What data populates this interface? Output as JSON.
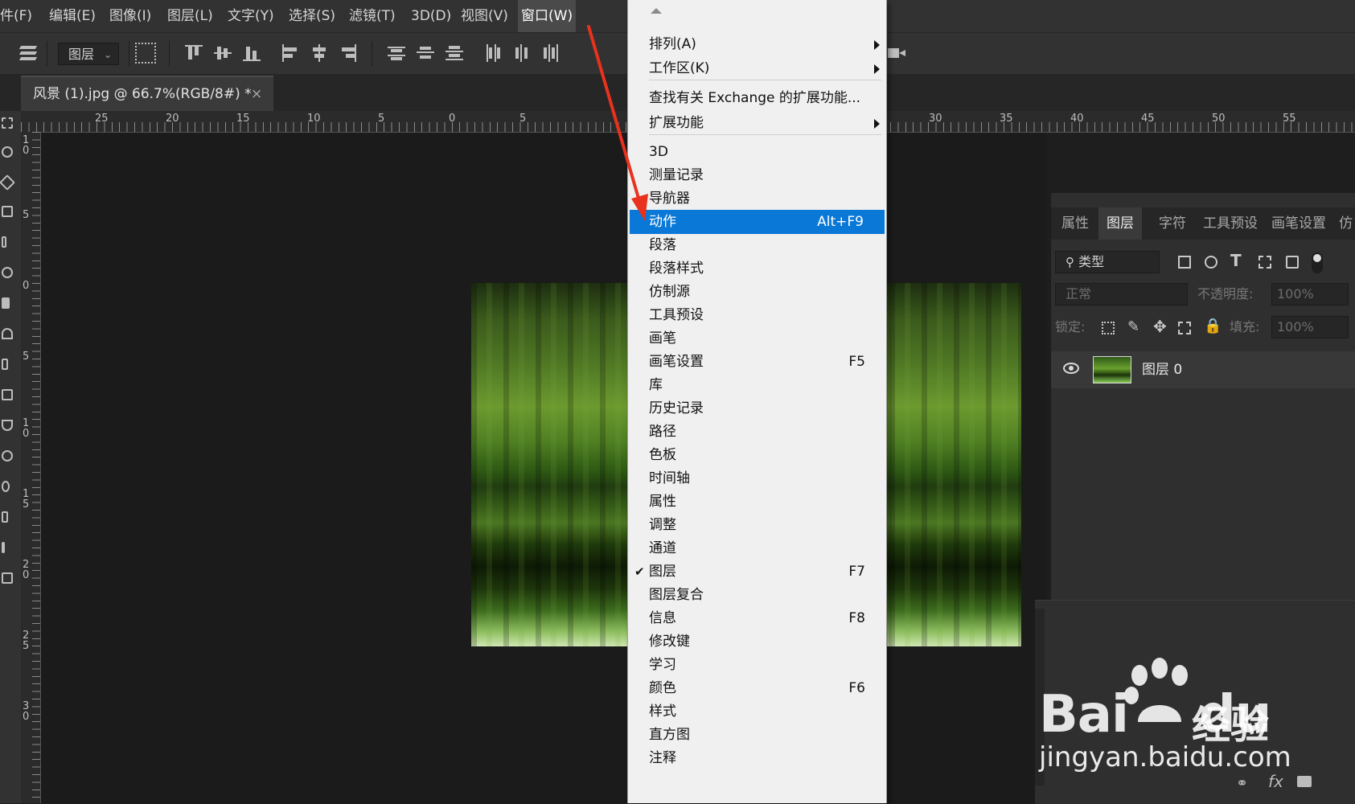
{
  "menubar": {
    "items": [
      "文件(F)",
      "编辑(E)",
      "图像(I)",
      "图层(L)",
      "文字(Y)",
      "选择(S)",
      "滤镜(T)",
      "3D(D)",
      "视图(V)",
      "窗口(W)"
    ],
    "visible_first": "件(F)"
  },
  "optionsbar": {
    "layer_select": "图层"
  },
  "document": {
    "tab_title": "风景 (1).jpg @ 66.7%(RGB/8#) *",
    "close": "×"
  },
  "ruler": {
    "h_labels": [
      "25",
      "20",
      "15",
      "10",
      "5",
      "0",
      "30",
      "35",
      "40",
      "45",
      "50",
      "55"
    ],
    "v_labels": [
      "1\n0",
      "5",
      "0",
      "5",
      "1\n0",
      "1\n5",
      "2\n0",
      "2\n5",
      "3\n0"
    ]
  },
  "window_menu": {
    "items": [
      {
        "label": "排列(A)",
        "submenu": true
      },
      {
        "label": "工作区(K)",
        "submenu": true
      },
      {
        "label": "查找有关 Exchange 的扩展功能..."
      },
      {
        "label": "扩展功能",
        "submenu": true
      },
      {
        "label": "3D"
      },
      {
        "label": "测量记录"
      },
      {
        "label": "导航器"
      },
      {
        "label": "动作",
        "shortcut": "Alt+F9",
        "highlighted": true
      },
      {
        "label": "段落"
      },
      {
        "label": "段落样式"
      },
      {
        "label": "仿制源"
      },
      {
        "label": "工具预设"
      },
      {
        "label": "画笔"
      },
      {
        "label": "画笔设置",
        "shortcut": "F5"
      },
      {
        "label": "库"
      },
      {
        "label": "历史记录"
      },
      {
        "label": "路径"
      },
      {
        "label": "色板"
      },
      {
        "label": "时间轴"
      },
      {
        "label": "属性"
      },
      {
        "label": "调整"
      },
      {
        "label": "通道"
      },
      {
        "label": "图层",
        "shortcut": "F7",
        "checked": true
      },
      {
        "label": "图层复合"
      },
      {
        "label": "信息",
        "shortcut": "F8"
      },
      {
        "label": "修改键"
      },
      {
        "label": "学习"
      },
      {
        "label": "颜色",
        "shortcut": "F6"
      },
      {
        "label": "样式"
      },
      {
        "label": "直方图"
      },
      {
        "label": "注释"
      }
    ],
    "check_mark": "✔"
  },
  "layers_panel": {
    "tabs": [
      "属性",
      "图层",
      "字符",
      "工具预设",
      "画笔设置",
      "仿"
    ],
    "active_tab": "图层",
    "filter": "类型",
    "blend_mode": "正常",
    "opacity_label": "不透明度:",
    "opacity_value": "100%",
    "lock_label": "锁定:",
    "fill_label": "填充:",
    "fill_value": "100%",
    "layer_name": "图层 0",
    "bottom_icons": [
      "link-icon",
      "fx-icon",
      "mask-icon"
    ],
    "fx_text": "fx"
  },
  "watermark": {
    "brand": "Bai",
    "brand_du": "du",
    "cn": "经验",
    "url": "jingyan.baidu.com"
  },
  "colors": {
    "menu_highlight": "#0a78d7",
    "ui_dark": "#323232",
    "arrow": "#e8321e"
  }
}
